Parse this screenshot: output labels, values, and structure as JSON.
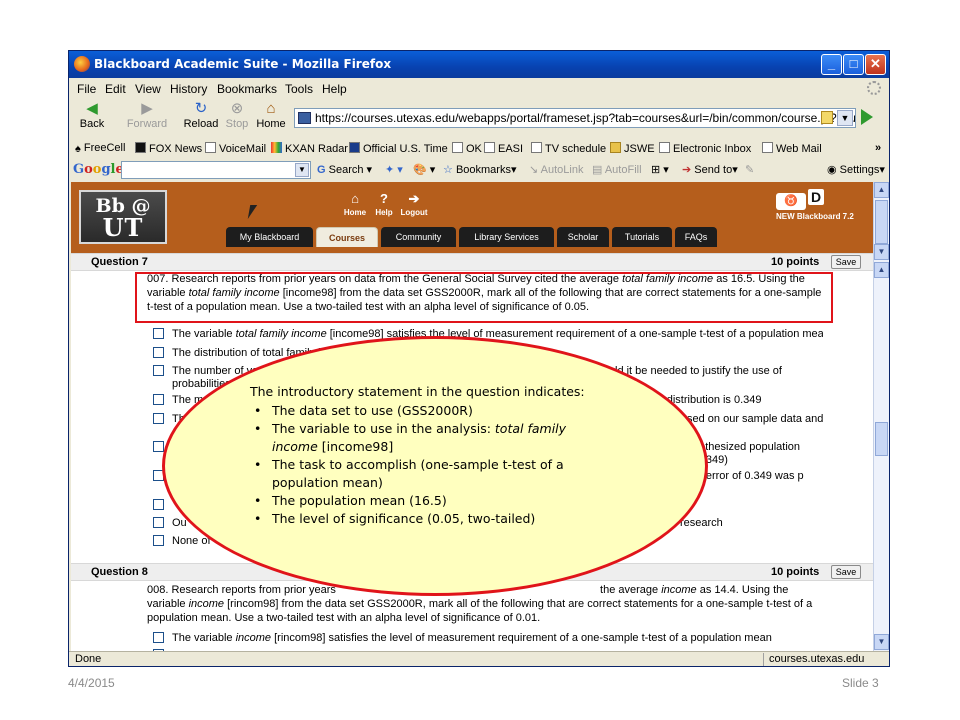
{
  "window": {
    "title": "Blackboard Academic Suite - Mozilla Firefox",
    "min_glyph": "_",
    "max_glyph": "□",
    "close_glyph": "✕"
  },
  "menu": [
    "File",
    "Edit",
    "View",
    "History",
    "Bookmarks",
    "Tools",
    "Help"
  ],
  "nav": {
    "back": "Back",
    "forward": "Forward",
    "reload": "Reload",
    "stop": "Stop",
    "home": "Home",
    "url": "https://courses.utexas.edu/webapps/portal/frameset.jsp?tab=courses&url=/bin/common/course.pl?course"
  },
  "bookmarks": [
    "FreeCell",
    "FOX News",
    "VoiceMail",
    "KXAN Radar",
    "Official U.S. Time",
    "OK",
    "EASI",
    "TV schedule",
    "JSWE",
    "Electronic Inbox",
    "Web Mail"
  ],
  "bookmarks_more": "»",
  "google_toolbar": {
    "logo": [
      "G",
      "o",
      "o",
      "g",
      "l",
      "e"
    ],
    "search": "Search",
    "bookmarks": "Bookmarks",
    "autolink": "AutoLink",
    "autofill": "AutoFill",
    "send_to": "Send to",
    "settings": "Settings"
  },
  "blackboard": {
    "logo_top": "Bb @",
    "logo_bottom": "UT",
    "home": "Home",
    "help": "Help",
    "logout": "Logout",
    "brand_letter": "D",
    "version": "NEW Blackboard 7.2",
    "tabs": [
      "My Blackboard",
      "Courses",
      "Community",
      "Library Services",
      "Scholar",
      "Tutorials",
      "FAQs"
    ],
    "active_tab": "Courses"
  },
  "question7": {
    "title": "Question 7",
    "points": "10 points",
    "save": "Save",
    "text_1": "007. Research reports from prior years on data from the General Social Survey cited the average ",
    "text_1_em": "total family income",
    "text_2": " as 16.5. Using the variable ",
    "text_2_em": "total family income",
    "text_3": " [income98] from the data set GSS2000R, mark all of the following that are correct statements for a one-sample t-test of a population mean. Use a two-tailed test with an alpha level of significance of 0.05.",
    "choices": [
      "The variable total family income [income98] satisfies the level of measurement requirement of a one-sample t-test of a population mean",
      "The distribution of total family i",
      "The number of va",
      "probabilities",
      "The m",
      "Th",
      "",
      "",
      "",
      "Ou",
      "None of"
    ],
    "choice_tails": [
      "",
      "",
      "ld it be needed to justify the use of",
      "",
      "ing distribution is 0.349",
      "sed on our sample data and",
      "pothesized population",
      "(0.349)",
      "rd error of 0.349 was p",
      "is research",
      ""
    ]
  },
  "question8": {
    "title": "Question 8",
    "points": "10 points",
    "save": "Save",
    "text_start": "008. Research reports from prior years ",
    "text_mid": " the average ",
    "text_mid_em": "income",
    "text_mid2": " as 14.4. Using the variable ",
    "text_mid2_em": "income",
    "text_rest": " [rincom98] from the data set GSS2000R, mark all of the following that are correct statements for a one-sample t-test of a population mean. Use a two-tailed test with an alpha level of significance of 0.01.",
    "choice1": "The variable income [rincom98] satisfies the level of measurement requirement of a one-sample t-test of a population mean"
  },
  "status": {
    "text": "Done",
    "host": "courses.utexas.edu"
  },
  "callout": {
    "intro": "The introductory statement in the question indicates:",
    "bullets": [
      "The data set to use (GSS2000R)",
      "The variable to  use in the analysis: total family income [income98]",
      "The task to accomplish (one-sample t-test of a population mean)",
      "The population mean (16.5)",
      "The level of significance (0.05, two-tailed)"
    ]
  },
  "footer": {
    "date": "4/4/2015",
    "slide": "Slide 3"
  },
  "colors": {
    "highlight_border": "#e0141a",
    "callout_fill": "#ffffbf",
    "blackboard_orange": "#b55e1c"
  }
}
